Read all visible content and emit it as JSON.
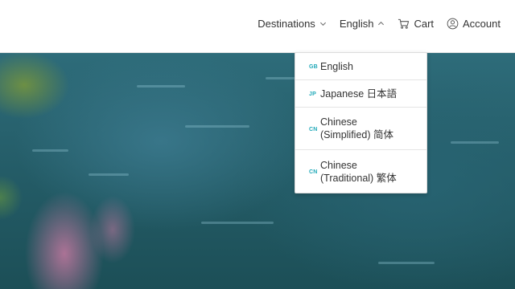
{
  "header": {
    "nav": {
      "destinations": "Destinations",
      "language": "English",
      "cart": "Cart",
      "account": "Account"
    }
  },
  "language_menu": {
    "items": [
      {
        "code": "GB",
        "label": "English"
      },
      {
        "code": "JP",
        "label": "Japanese 日本語"
      },
      {
        "code": "CN",
        "label": "Chinese\n(Simplified) 简体"
      },
      {
        "code": "CN",
        "label": "Chinese\n(Traditional) 繁体"
      }
    ]
  },
  "colors": {
    "accent": "#1fa8b8",
    "header_bg": "#ffffff",
    "text": "#333333"
  },
  "icons": {
    "destinations_chevron": "chevron-down-icon",
    "language_chevron": "chevron-up-icon",
    "cart": "cart-icon",
    "account": "account-icon"
  }
}
